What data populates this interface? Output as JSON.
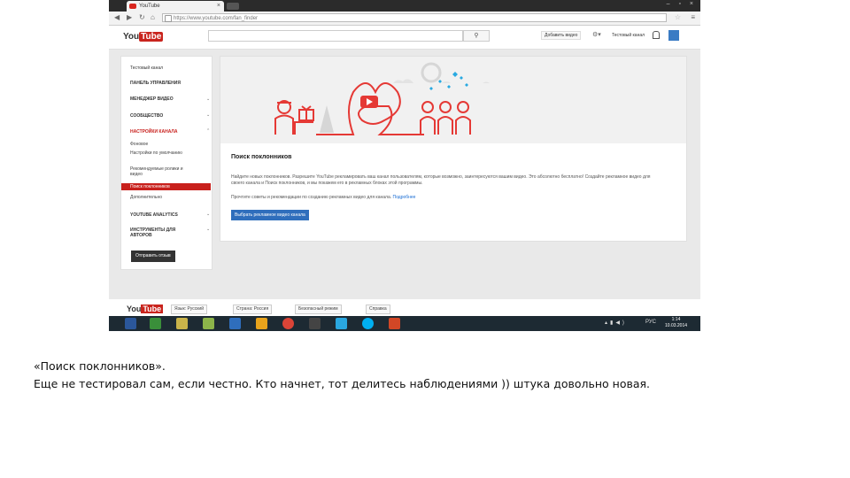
{
  "browser": {
    "tab_title": "YouTube",
    "url": "https://www.youtube.com/fan_finder"
  },
  "youtube": {
    "logo_you": "You",
    "logo_tube": "Tube",
    "upload_label": "Добавить видео",
    "channel_name": "Тестовый канал"
  },
  "sidebar": {
    "channel_name": "Тестовый канал",
    "items": [
      {
        "label": "Панель управления"
      },
      {
        "label": "Менеджер видео"
      },
      {
        "label": "Сообщество"
      },
      {
        "label": "Настройки канала"
      },
      {
        "label": "Фоновое"
      },
      {
        "label": "Настройки по умолчанию"
      },
      {
        "label": "Рекомендуемые ролики и видео"
      },
      {
        "label": "Поиск поклонников"
      },
      {
        "label": "Дополнительно"
      },
      {
        "label": "YouTube Analytics"
      },
      {
        "label": "Инструменты для авторов"
      }
    ],
    "feedback_button": "Отправить отзыв"
  },
  "main": {
    "title": "Поиск поклонников",
    "description": "Найдите новых поклонников. Разрешите YouTube рекламировать ваш канал пользователям, которые возможно, заинтересуются вашим видео. Это абсолютно бесплатно! Создайте рекламное видео для своего канала и Поиск поклонников, и мы покажем его в рекламных блоках этой программы.",
    "policy_text": "Прочтите советы и рекомендации по созданию рекламных видео для канала.",
    "policy_link": "Подробнее",
    "cta_button": "Выбрать рекламное видео канала"
  },
  "footer": {
    "logo_you": "You",
    "logo_tube": "Tube",
    "language": "Язык: Русский",
    "country": "Страна: Россия",
    "safety": "Безопасный режим",
    "help": "Справка"
  },
  "taskbar": {
    "lang": "РУС",
    "time": "1:14",
    "date": "10.03.2014"
  },
  "caption": {
    "line1": "«Поиск поклонников».",
    "line2": "Еще не тестировал сам, если честно. Кто начнет, тот делитесь наблюдениями )) штука довольно новая."
  },
  "colors": {
    "youtube_red": "#c8201c",
    "button_blue": "#2f6ebc",
    "taskbar": "#1d2a33"
  }
}
